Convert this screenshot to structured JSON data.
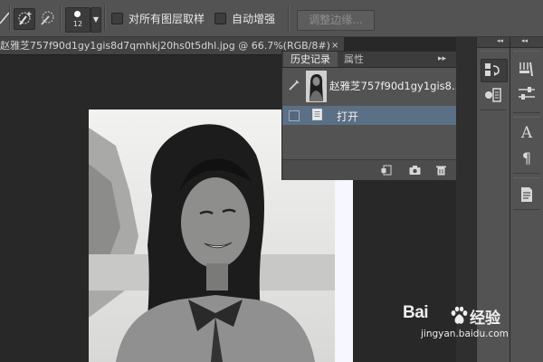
{
  "options_bar": {
    "brush_size": "12",
    "sample_all_layers_label": "对所有图层取样",
    "auto_enhance_label": "自动增强",
    "refine_edge_label": "调整边缘..."
  },
  "document_tab": {
    "title": "赵雅芝757f90d1gy1gis8d7qmhkj20hs0t5dhl.jpg @ 66.7%(RGB/8#)",
    "close_symbol": "×"
  },
  "history_panel": {
    "tabs": [
      "历史记录",
      "属性"
    ],
    "collapse_symbol": "▸▸",
    "snapshot_name": "赵雅芝757f90d1gy1gis8...",
    "steps": [
      {
        "label": "打开",
        "selected": true
      }
    ],
    "footer_icons": [
      "new-document-from-state-icon",
      "snapshot-camera-icon",
      "trash-icon"
    ]
  },
  "dock": {
    "collapse_symbol": "◂◂",
    "column1_icons": [
      "history-panel-icon",
      "actions-panel-icon"
    ],
    "column2_icons": [
      "brush-panel-icon",
      "adjustment-sliders-icon",
      "character-icon",
      "paragraph-icon",
      "notes-icon"
    ],
    "character_glyph": "A",
    "paragraph_glyph": "¶"
  },
  "watermark": {
    "logo_text": "Bai",
    "logo_suffix": "经验",
    "url": "jingyan.baidu.com"
  },
  "colors": {
    "panel_bg": "#535353",
    "canvas_bg": "#282828",
    "selected_row": "#5b6f85"
  }
}
